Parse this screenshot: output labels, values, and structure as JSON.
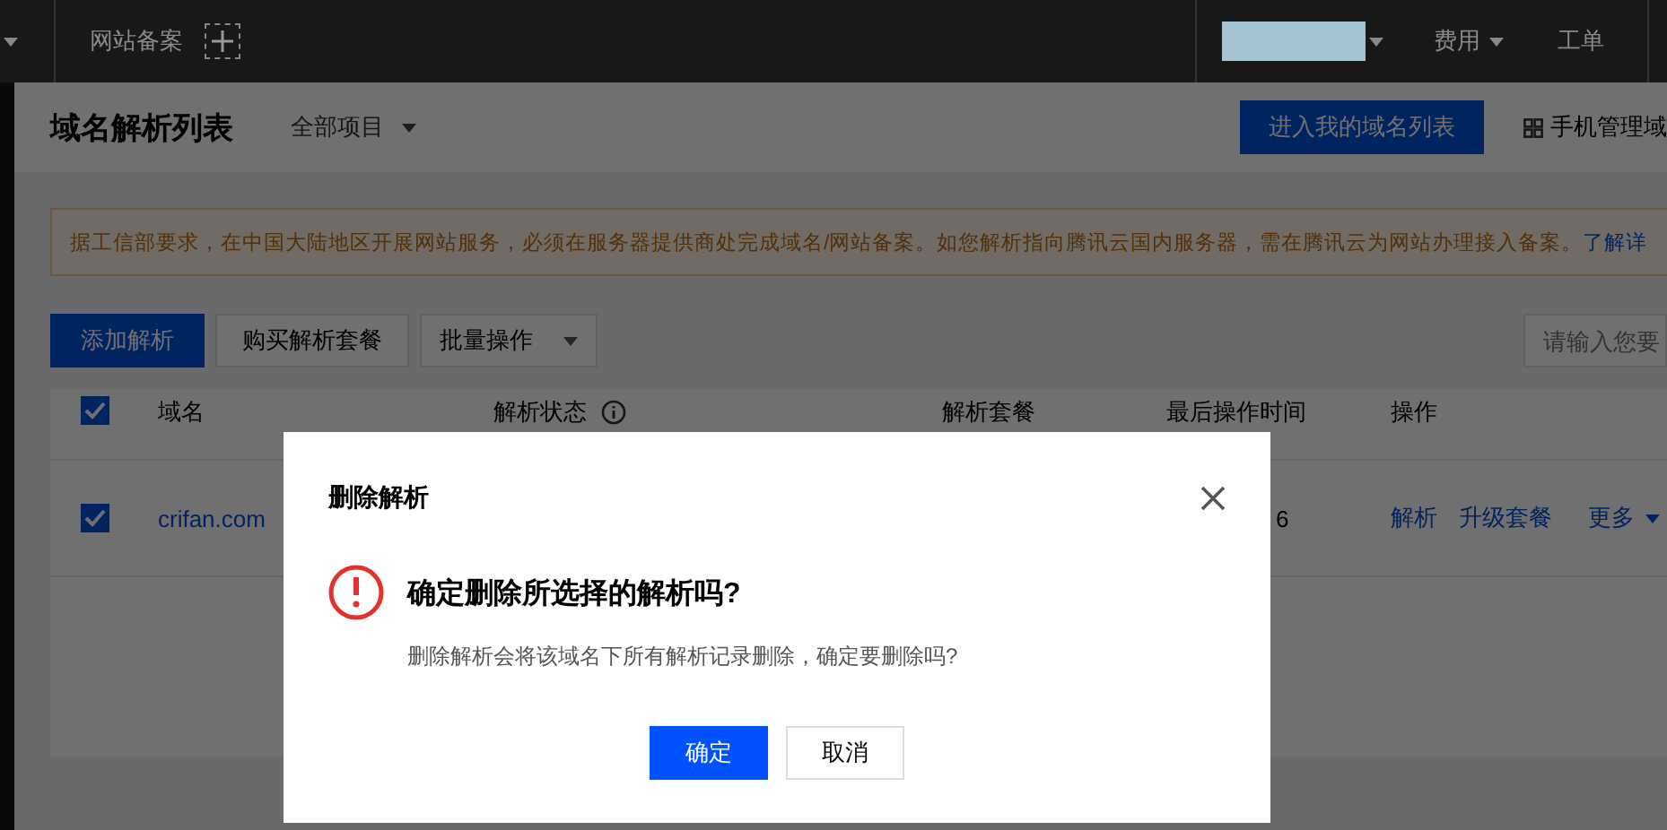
{
  "top_bar": {
    "links": [
      "网站备案"
    ],
    "menus": [
      {
        "label": "费用",
        "dropdown": true
      },
      {
        "label": "工单",
        "dropdown": false
      }
    ]
  },
  "header": {
    "title": "域名解析列表",
    "project_filter": "全部项目",
    "primary_button": "进入我的域名列表",
    "mobile_link": "手机管理域"
  },
  "notice": {
    "text": "据工信部要求，在中国大陆地区开展网站服务，必须在服务器提供商处完成域名/网站备案。如您解析指向腾讯云国内服务器，需在腾讯云为网站办理接入备案。",
    "link": "了解详"
  },
  "toolbar": {
    "buttons": [
      {
        "label": "添加解析",
        "kind": "primary"
      },
      {
        "label": "购买解析套餐",
        "kind": "default"
      }
    ],
    "batch_select": "批量操作",
    "search": {
      "placeholder": "请输入您要"
    }
  },
  "table": {
    "select_all_checked": true,
    "columns": [
      {
        "label": "域名",
        "info": false
      },
      {
        "label": "解析状态",
        "info": true
      },
      {
        "label": "解析套餐",
        "info": false
      },
      {
        "label": "最后操作时间",
        "info": false
      },
      {
        "label": "操作",
        "info": false
      }
    ],
    "rows": [
      {
        "checked": true,
        "domain": "crifan.com",
        "last_operation_time": "6",
        "actions": [
          "解析",
          "升级套餐"
        ],
        "more": "更多"
      }
    ]
  },
  "dialog": {
    "title": "删除解析",
    "heading": "确定删除所选择的解析吗?",
    "message": "删除解析会将该域名下所有解析记录删除，确定要删除吗?",
    "buttons": [
      {
        "label": "确定",
        "kind": "primary"
      },
      {
        "label": "取消",
        "kind": "default"
      }
    ]
  }
}
